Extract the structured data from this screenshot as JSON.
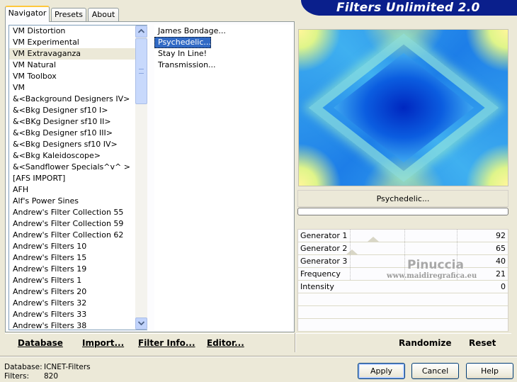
{
  "header": {
    "title": "Filters Unlimited 2.0"
  },
  "tabs": [
    {
      "label": "Navigator",
      "active": true
    },
    {
      "label": "Presets",
      "active": false
    },
    {
      "label": "About",
      "active": false
    }
  ],
  "categories": {
    "items": [
      "VM Distortion",
      "VM Experimental",
      "VM Extravaganza",
      "VM Natural",
      "VM Toolbox",
      "VM",
      "&<Background Designers IV>",
      "&<Bkg Designer sf10 I>",
      "&<BKg Designer sf10 II>",
      "&<Bkg Designer sf10 III>",
      "&<Bkg Designers sf10 IV>",
      "&<Bkg Kaleidoscope>",
      "&<Sandflower Specials^v^ >",
      "[AFS IMPORT]",
      "AFH",
      "Alf's Power Sines",
      "Andrew's Filter Collection 55",
      "Andrew's Filter Collection 59",
      "Andrew's Filter Collection 62",
      "Andrew's Filters 10",
      "Andrew's Filters 15",
      "Andrew's Filters 19",
      "Andrew's Filters 1",
      "Andrew's Filters 20",
      "Andrew's Filters 32",
      "Andrew's Filters 33",
      "Andrew's Filters 38"
    ],
    "selected": "VM Extravaganza"
  },
  "filters": {
    "items": [
      "James Bondage...",
      "Psychedelic...",
      "Stay In Line!",
      "Transmission..."
    ],
    "selected": "Psychedelic..."
  },
  "scrollbar": {
    "up_icon": "scroll-up-arrow",
    "down_icon": "scroll-down-arrow"
  },
  "preview": {
    "colors": {
      "center": "#0033c8",
      "mid": "#3fb0f0",
      "corner": "#fff79a"
    }
  },
  "current_filter": "Psychedelic...",
  "parameters": [
    {
      "name": "Generator 1",
      "value": "92"
    },
    {
      "name": "Generator 2",
      "value": "65"
    },
    {
      "name": "Generator 3",
      "value": "40"
    },
    {
      "name": "Frequency",
      "value": "21"
    },
    {
      "name": "Intensity",
      "value": "0"
    }
  ],
  "watermark": {
    "title": "Pinuccia",
    "url": "www.maidiregrafica.eu"
  },
  "toolbar": {
    "database": "Database",
    "import": "Import...",
    "filter_info": "Filter Info...",
    "editor": "Editor...",
    "randomize": "Randomize",
    "reset": "Reset"
  },
  "status": {
    "database_label": "Database:",
    "database_value": "ICNET-Filters",
    "filters_label": "Filters:",
    "filters_value": "820"
  },
  "buttons": {
    "apply": "Apply",
    "cancel": "Cancel",
    "help": "Help"
  },
  "accent_colors": {
    "banner": "#0a1f8c",
    "selection": "#316ac5",
    "tab_highlight": "#ffc83c"
  }
}
